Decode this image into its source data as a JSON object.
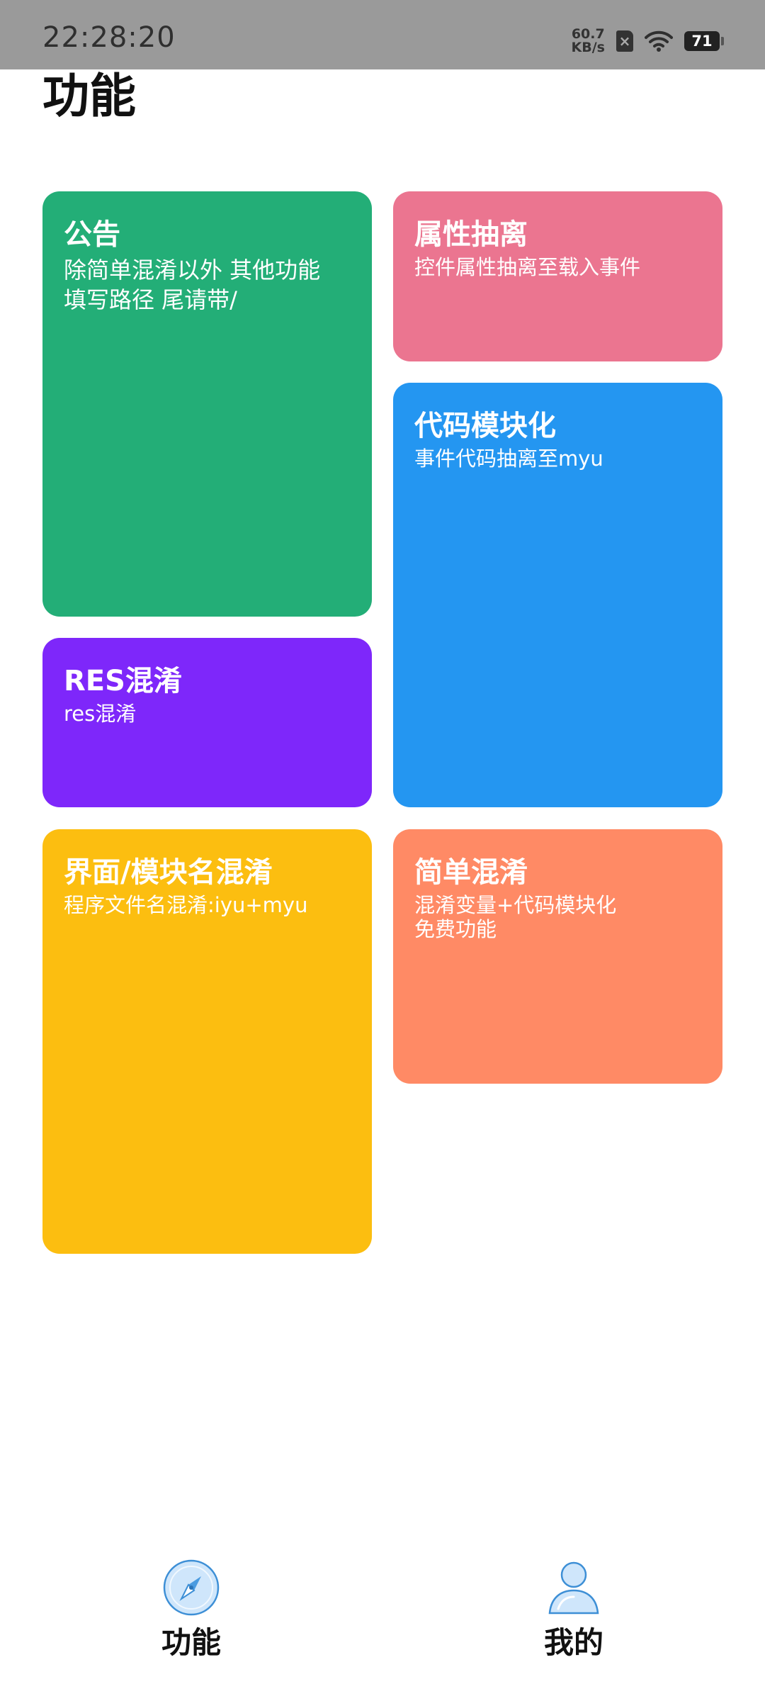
{
  "status_bar": {
    "time": "22:28:20",
    "net_speed_value": "60.7",
    "net_speed_unit": "KB/s",
    "sim_glyph": "×",
    "battery_level": "71"
  },
  "page": {
    "title": "功能"
  },
  "cards": {
    "notice": {
      "title": "公告",
      "desc": "除简单混淆以外 其他功能\n填写路径 尾请带/",
      "color": "#23AE77"
    },
    "attr_extract": {
      "title": "属性抽离",
      "desc": "控件属性抽离至载入事件",
      "color": "#EB7590"
    },
    "code_module": {
      "title": "代码模块化",
      "desc": "事件代码抽离至myu",
      "color": "#2496F1"
    },
    "res_obfuscate": {
      "title": "RES混淆",
      "desc": "res混淆",
      "color": "#7E27FA"
    },
    "ui_module_name": {
      "title": "界面/模块名混淆",
      "desc": "程序文件名混淆:iyu+myu",
      "color": "#FCBE10"
    },
    "simple_obfuscate": {
      "title": "简单混淆",
      "desc": "混淆变量+代码模块化\n免费功能",
      "color": "#FF8A65"
    }
  },
  "bottom_nav": {
    "items": [
      {
        "label": "功能",
        "icon": "compass-icon"
      },
      {
        "label": "我的",
        "icon": "person-icon"
      }
    ]
  }
}
